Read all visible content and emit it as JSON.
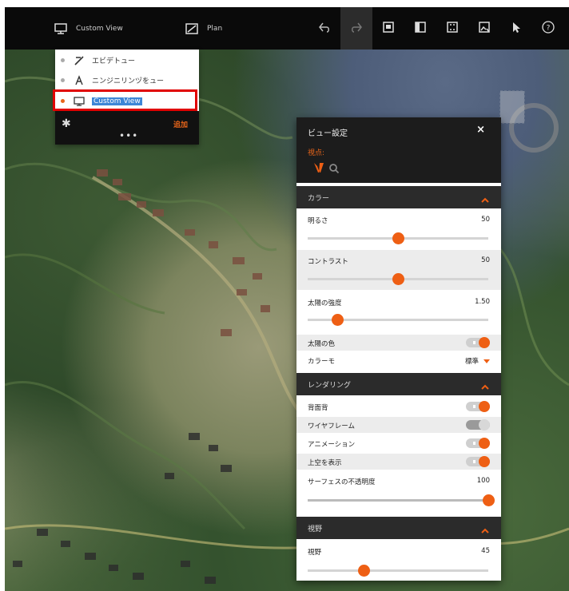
{
  "toolbar": {
    "view_label": "Custom View",
    "plan_label": "Plan",
    "buttons": [
      "undo-icon",
      "redo-icon",
      "export-icon",
      "panel-icon",
      "snapshot-icon",
      "export-image-icon",
      "pointer-icon",
      "help-icon"
    ]
  },
  "view_menu": {
    "items": [
      {
        "label": "エビデトュー",
        "icon": "survey-view-icon"
      },
      {
        "label": "ニンジニリンヅをュー",
        "icon": "engineering-view-icon"
      },
      {
        "label": "Custom View",
        "icon": "custom-view-icon",
        "selected": true
      }
    ],
    "add_label": "追加",
    "more_label": "•••"
  },
  "panel": {
    "title": "ビュー設定",
    "close": "×",
    "preset_label": "視点: ",
    "sections": {
      "color": {
        "title": "カラー",
        "brightness": {
          "label": "明るさ",
          "value": "50"
        },
        "contrast": {
          "label": "コントラスト",
          "value": "50"
        },
        "sun_intensity": {
          "label": "太陽の強度",
          "value": "1.50"
        },
        "sun_color": {
          "label": "太陽の色"
        },
        "color_mode": {
          "label": "カラーモ",
          "value": "標準"
        }
      },
      "rendering": {
        "title": "レンダリング",
        "hidden_layers": {
          "label": "背面背"
        },
        "wireframe": {
          "label": "ワイヤフレーム"
        },
        "animation": {
          "label": "アニメーション"
        },
        "sky": {
          "label": "上空を表示"
        },
        "surface": {
          "label": "サーフェスの不透明度",
          "value": "100"
        }
      },
      "field": {
        "title": "視野",
        "fov": {
          "label": "視野",
          "value": "45"
        }
      }
    }
  },
  "colors": {
    "accent": "#ee5f14",
    "highlight": "#e00000",
    "selection": "#3d86d6"
  }
}
